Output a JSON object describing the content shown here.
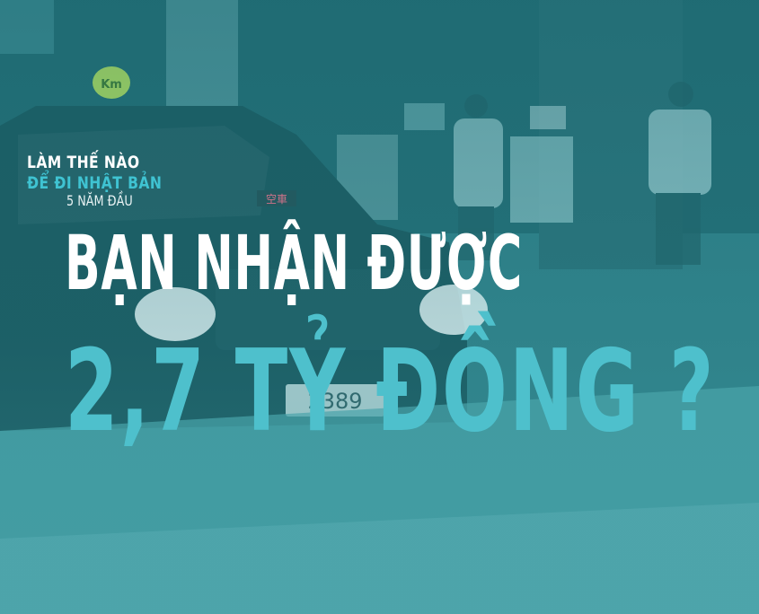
{
  "taxi_sign": "Km",
  "vacancy_sign": "空車",
  "plate_number": "2389",
  "kicker_line1": "LÀM THẾ NÀO",
  "kicker_line2": "ĐỂ ĐI NHẬT BẢN",
  "subtitle": "5 NĂM ĐẦU",
  "headline_line1": "BẠN NHẬN ĐƯỢC",
  "headline_line2": "2,7 TỶ ĐỒNG ?",
  "colors": {
    "tint": "#3a8f96",
    "accent": "#4ec0cc",
    "headline": "#ffffff"
  }
}
